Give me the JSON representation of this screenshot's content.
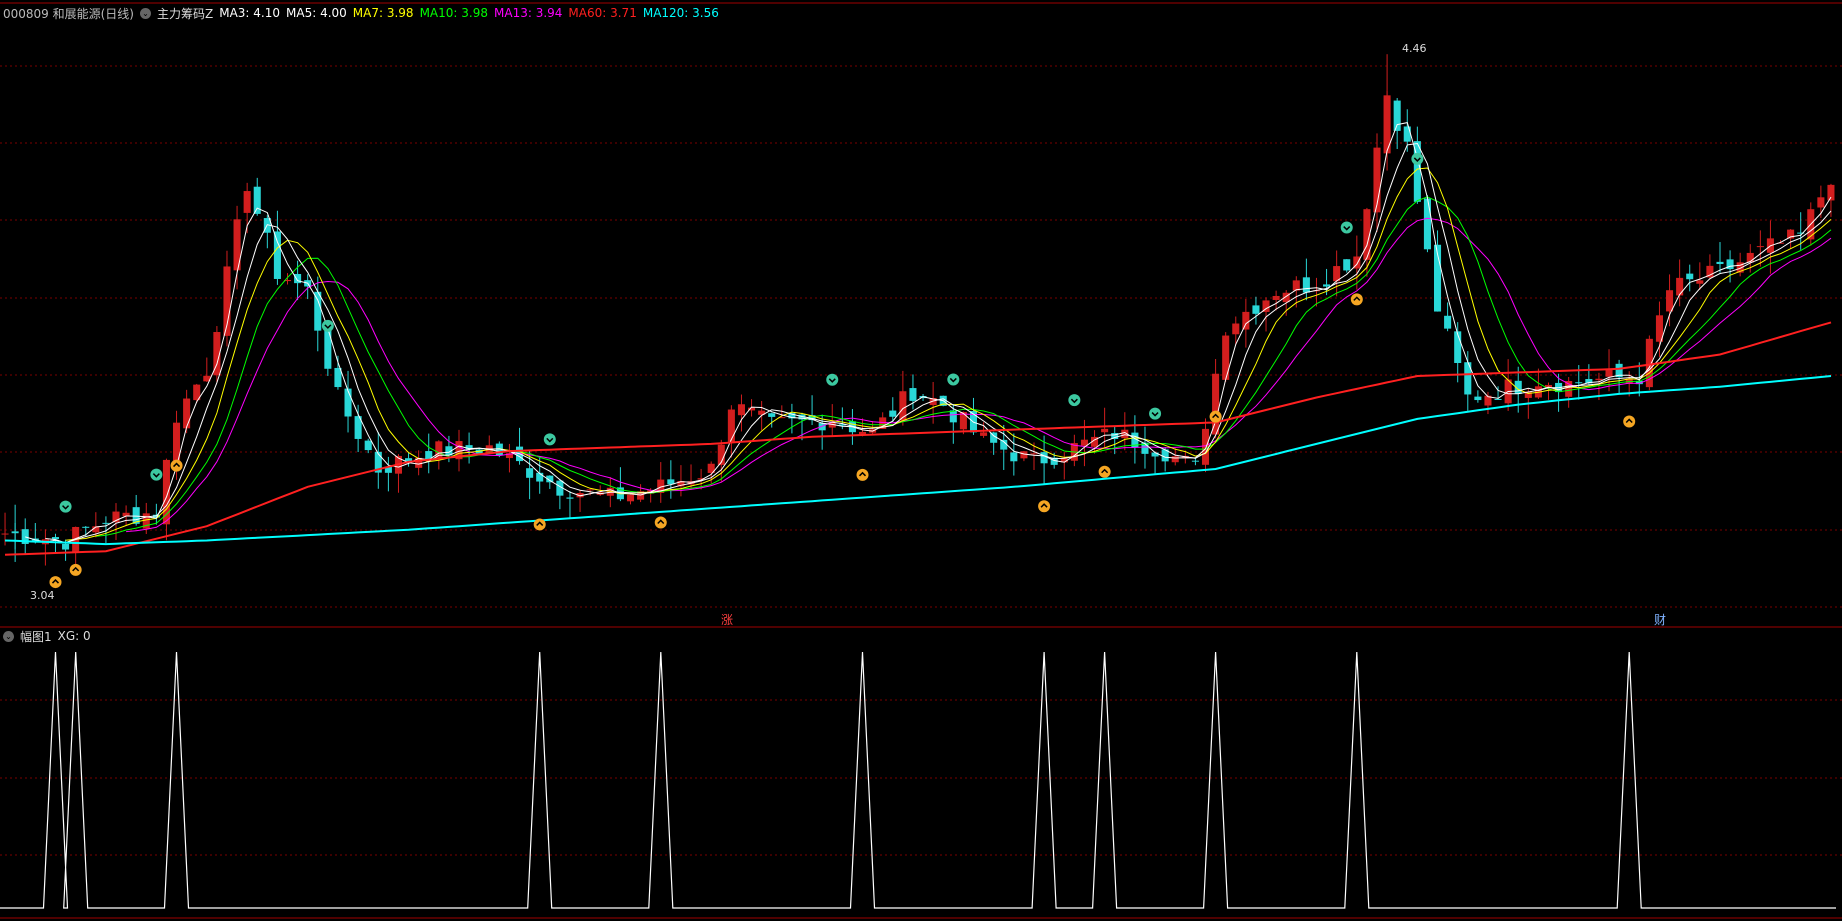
{
  "colors": {
    "bg": "#000000",
    "grid": "#7a0000",
    "up": "#d21e1e",
    "down": "#29d7d7",
    "ma3": "#ffffff",
    "ma5": "#ffffff",
    "ma7": "#ffff00",
    "ma10": "#00ff00",
    "ma13": "#ff00ff",
    "ma60": "#ff2020",
    "ma120": "#00ffff"
  },
  "header": {
    "stock": "000809 和展能源(日线)",
    "indicator": "主力筹码Z",
    "ma_labels": [
      {
        "text": "MA3: 4.10",
        "color": "#ffffff"
      },
      {
        "text": "MA5: 4.00",
        "color": "#ffffff"
      },
      {
        "text": "MA7: 3.98",
        "color": "#ffff00"
      },
      {
        "text": "MA10: 3.98",
        "color": "#00ff00"
      },
      {
        "text": "MA13: 3.94",
        "color": "#ff00ff"
      },
      {
        "text": "MA60: 3.71",
        "color": "#ff2020"
      },
      {
        "text": "MA120: 3.56",
        "color": "#00ffff"
      }
    ]
  },
  "sub_header": {
    "name": "幅图1",
    "value": "XG: 0"
  },
  "annotations": {
    "high_label": "4.46",
    "low_label": "3.04",
    "mark_zhang": "涨",
    "mark_cai": "财"
  },
  "chart_data": [
    {
      "type": "candlestick",
      "title": "000809 和展能源(日线)",
      "ylim": [
        2.9,
        4.55
      ],
      "high": 4.46,
      "low": 3.04,
      "x_count": 182,
      "close_keypoints": [
        [
          0,
          3.12
        ],
        [
          6,
          3.1
        ],
        [
          10,
          3.16
        ],
        [
          15,
          3.18
        ],
        [
          17,
          3.45
        ],
        [
          20,
          3.58
        ],
        [
          24,
          4.1
        ],
        [
          27,
          3.85
        ],
        [
          30,
          3.8
        ],
        [
          33,
          3.5
        ],
        [
          37,
          3.3
        ],
        [
          42,
          3.35
        ],
        [
          48,
          3.36
        ],
        [
          55,
          3.25
        ],
        [
          60,
          3.22
        ],
        [
          65,
          3.25
        ],
        [
          70,
          3.3
        ],
        [
          72,
          3.48
        ],
        [
          76,
          3.42
        ],
        [
          82,
          3.44
        ],
        [
          86,
          3.4
        ],
        [
          90,
          3.52
        ],
        [
          93,
          3.48
        ],
        [
          97,
          3.38
        ],
        [
          102,
          3.32
        ],
        [
          105,
          3.35
        ],
        [
          110,
          3.4
        ],
        [
          115,
          3.35
        ],
        [
          118,
          3.3
        ],
        [
          121,
          3.7
        ],
        [
          126,
          3.8
        ],
        [
          130,
          3.82
        ],
        [
          134,
          3.9
        ],
        [
          137,
          4.35
        ],
        [
          139,
          4.2
        ],
        [
          142,
          3.75
        ],
        [
          145,
          3.5
        ],
        [
          148,
          3.52
        ],
        [
          152,
          3.55
        ],
        [
          155,
          3.54
        ],
        [
          158,
          3.55
        ],
        [
          162,
          3.56
        ],
        [
          165,
          3.8
        ],
        [
          170,
          3.85
        ],
        [
          175,
          3.92
        ],
        [
          178,
          3.95
        ],
        [
          181,
          4.12
        ]
      ],
      "ma60_keypoints": [
        [
          0,
          3.06
        ],
        [
          10,
          3.07
        ],
        [
          20,
          3.14
        ],
        [
          30,
          3.25
        ],
        [
          40,
          3.32
        ],
        [
          50,
          3.35
        ],
        [
          60,
          3.36
        ],
        [
          70,
          3.37
        ],
        [
          80,
          3.39
        ],
        [
          90,
          3.4
        ],
        [
          100,
          3.41
        ],
        [
          110,
          3.42
        ],
        [
          120,
          3.43
        ],
        [
          130,
          3.5
        ],
        [
          140,
          3.56
        ],
        [
          150,
          3.57
        ],
        [
          160,
          3.58
        ],
        [
          170,
          3.62
        ],
        [
          181,
          3.71
        ]
      ],
      "ma120_keypoints": [
        [
          0,
          3.1
        ],
        [
          10,
          3.09
        ],
        [
          20,
          3.1
        ],
        [
          40,
          3.13
        ],
        [
          60,
          3.17
        ],
        [
          80,
          3.21
        ],
        [
          100,
          3.25
        ],
        [
          120,
          3.3
        ],
        [
          140,
          3.44
        ],
        [
          150,
          3.48
        ],
        [
          160,
          3.51
        ],
        [
          170,
          3.53
        ],
        [
          181,
          3.56
        ]
      ],
      "signal_markers_down": [
        5,
        7,
        17,
        53,
        65,
        85,
        103,
        109,
        120,
        134,
        161
      ],
      "signal_markers_up": [
        6,
        15,
        32,
        54,
        82,
        94,
        106,
        114,
        133,
        140
      ]
    },
    {
      "type": "line",
      "title": "幅图1",
      "series": [
        {
          "name": "XG",
          "values_nonzero_at": [
            5,
            7,
            17,
            53,
            65,
            85,
            103,
            109,
            120,
            134,
            161
          ]
        }
      ],
      "ylim": [
        0,
        1
      ]
    }
  ]
}
